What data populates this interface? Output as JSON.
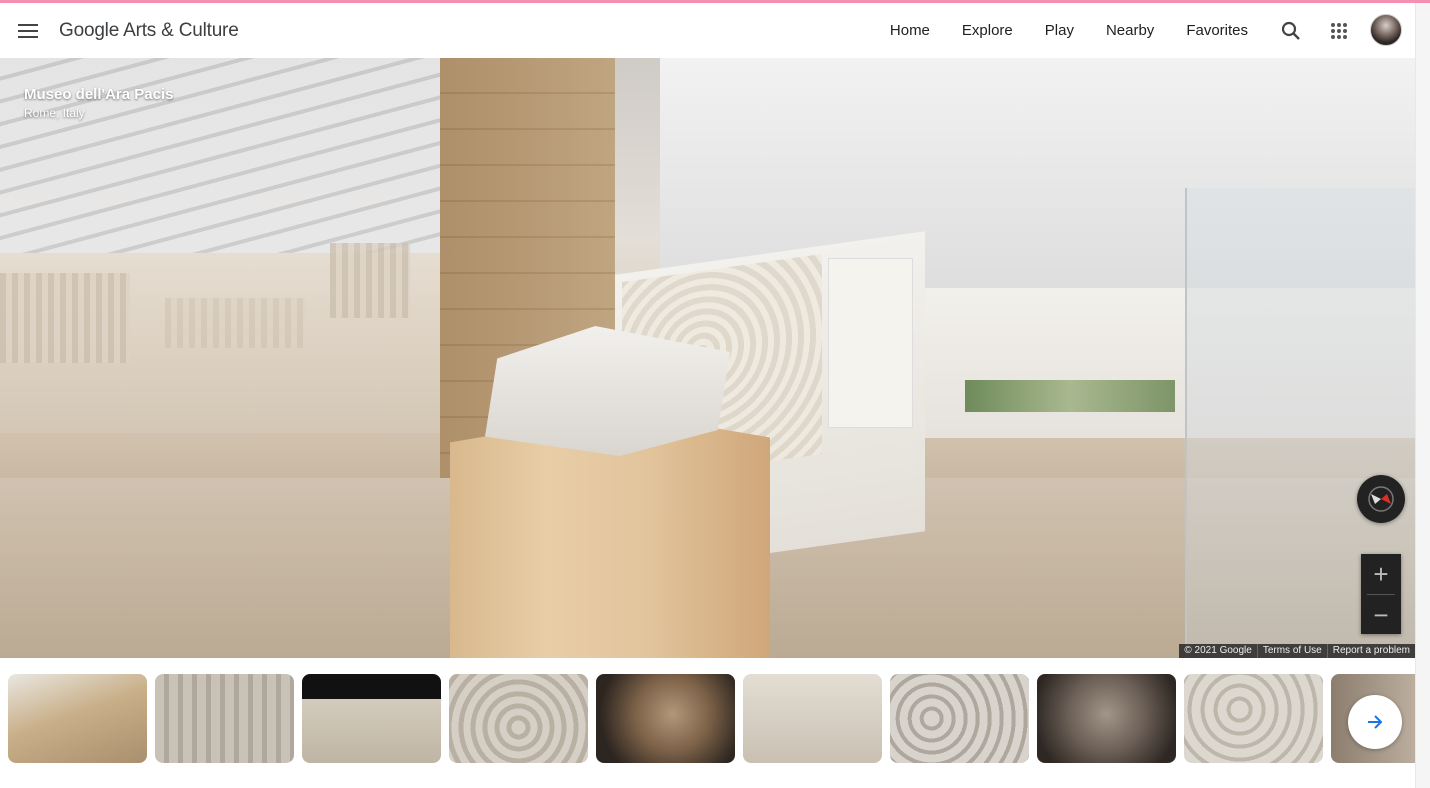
{
  "app": {
    "logo_text": "Google Arts & Culture",
    "menu_icon": "hamburger-menu-icon"
  },
  "nav": {
    "items": [
      {
        "label": "Home"
      },
      {
        "label": "Explore"
      },
      {
        "label": "Play"
      },
      {
        "label": "Nearby"
      },
      {
        "label": "Favorites"
      }
    ],
    "search_icon": "search-icon",
    "apps_icon": "apps-grid-icon",
    "avatar_icon": "account-avatar"
  },
  "viewer": {
    "place_title": "Museo dell'Ara Pacis",
    "place_location": "Rome, Italy",
    "compass_icon": "compass-icon",
    "zoom_in_label": "+",
    "zoom_out_label": "−",
    "attribution": {
      "copyright": "© 2021 Google",
      "terms": "Terms of Use",
      "report": "Report a problem"
    }
  },
  "filmstrip": {
    "thumbnails": [
      {
        "subject": "museum-interior-thumbnail",
        "color": "#b9a27e"
      },
      {
        "subject": "procession-relief-thumbnail",
        "color": "#c8c0b4"
      },
      {
        "subject": "pediment-scroll-thumbnail",
        "color": "#cfc6b8"
      },
      {
        "subject": "acanthus-rosette-thumbnail",
        "color": "#cbc3b8"
      },
      {
        "subject": "sculpted-head-thumbnail",
        "color": "#8a6f57"
      },
      {
        "subject": "tellus-relief-thumbnail",
        "color": "#d6cec3"
      },
      {
        "subject": "floral-panel-thumbnail",
        "color": "#c9c4bd"
      },
      {
        "subject": "portrait-bust-thumbnail",
        "color": "#6e6259"
      },
      {
        "subject": "vine-scroll-thumbnail",
        "color": "#d3cdc4"
      },
      {
        "subject": "relief-fragment-thumbnail",
        "color": "#a8998a"
      }
    ],
    "next_icon": "arrow-right-icon"
  },
  "colors": {
    "accent_top_line": "#f48fb1",
    "next_arrow": "#1a73e8",
    "text_primary": "#202124"
  }
}
